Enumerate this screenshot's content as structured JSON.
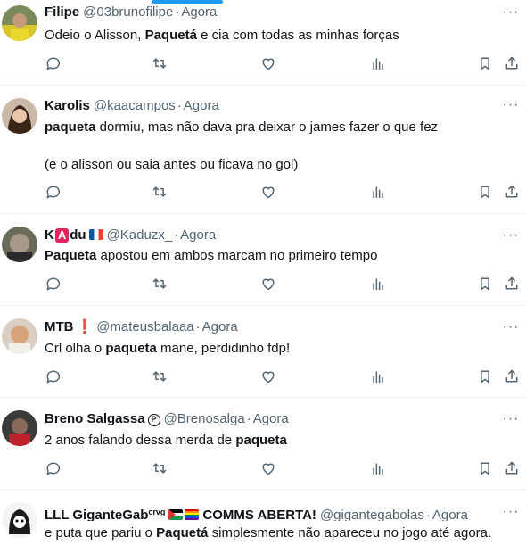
{
  "tweets": [
    {
      "name": "Filipe",
      "handle": "@03brunofilipe",
      "sep": "·",
      "time": "Agora",
      "text": [
        {
          "t": "Odeio o Alisson, ",
          "b": false
        },
        {
          "t": "Paquetá",
          "b": true
        },
        {
          "t": " e cia com todas as minhas forças",
          "b": false
        }
      ]
    },
    {
      "name": "Karolis",
      "handle": "@kaacampos",
      "sep": "·",
      "time": "Agora",
      "text": [
        {
          "t": "paqueta",
          "b": true
        },
        {
          "t": " dormiu, mas não dava pra deixar o james fazer o que fez",
          "b": false
        }
      ],
      "text2": "(e o alisson ou saia antes ou ficava no gol)"
    },
    {
      "name_prefix": "K",
      "name_badge": "A",
      "name_suffix": "du",
      "name_flag": "france-flag",
      "handle": "@Kaduzx_",
      "sep": "·",
      "time": "Agora",
      "text": [
        {
          "t": "Paqueta",
          "b": true
        },
        {
          "t": " apostou em ambos marcam no primeiro tempo",
          "b": false
        }
      ]
    },
    {
      "name": "MTB",
      "name_mark": "❗",
      "handle": "@mateusbalaaa",
      "sep": "·",
      "time": "Agora",
      "text": [
        {
          "t": "Crl olha o ",
          "b": false
        },
        {
          "t": "paqueta",
          "b": true
        },
        {
          "t": " mane, perdidinho fdp!",
          "b": false
        }
      ]
    },
    {
      "name": "Breno Salgassa",
      "name_mark": "P",
      "handle": "@Brenosalga",
      "sep": "·",
      "time": "Agora",
      "text": [
        {
          "t": "2 anos falando dessa merda de ",
          "b": false
        },
        {
          "t": "paqueta",
          "b": true
        }
      ]
    },
    {
      "name": "LLL GiganteGab",
      "name_sup": "crvg",
      "name_flags": [
        "palestine-flag",
        "pride-flag"
      ],
      "name_suffix": "COMMS ABERTA!",
      "handle": "@gigantegabolas",
      "sep": "·",
      "time": "Agora",
      "text": [
        {
          "t": "e puta que pariu o ",
          "b": false
        },
        {
          "t": "Paquetá",
          "b": true
        },
        {
          "t": " simplesmente não apareceu no jogo até agora.",
          "b": false
        }
      ]
    }
  ],
  "more_label": "···",
  "actions": [
    "reply-icon",
    "retweet-icon",
    "like-icon",
    "views-icon",
    "bookmark-icon",
    "share-icon"
  ],
  "colors": {
    "accent": "#1d9bf0",
    "muted": "#536471",
    "text": "#0f1419",
    "divider": "#eff3f4"
  }
}
